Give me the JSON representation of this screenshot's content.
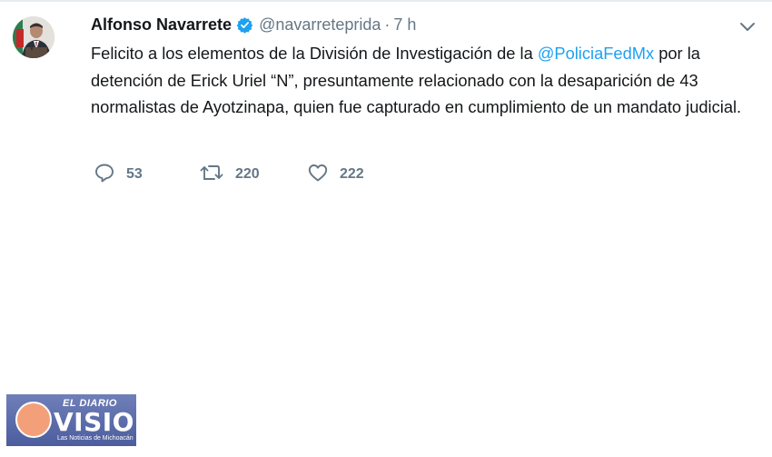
{
  "tweet": {
    "author": {
      "name": "Alfonso Navarrete",
      "handle": "@navarreteprida",
      "verified": true
    },
    "separator": "·",
    "time": "7 h",
    "text_parts": {
      "before": "Felicito a los elementos de la División de Investigación de la ",
      "mention": "@PoliciaFedMx",
      "after": " por la detención de Erick Uriel “N”, presuntamente relacionado con la desaparición de 43 normalistas de Ayotzinapa, quien fue capturado en cumplimiento de un mandato judicial."
    },
    "actions": {
      "replies": "53",
      "retweets": "220",
      "likes": "222"
    }
  },
  "icons": {
    "reply": "reply-icon",
    "retweet": "retweet-icon",
    "like": "heart-icon",
    "menu": "chevron-down-icon",
    "verified": "verified-badge-icon"
  },
  "colors": {
    "text": "#14171a",
    "muted": "#657786",
    "mention": "#1da1f2",
    "verified": "#1da1f2",
    "logo_background": "#5566a8",
    "logo_sun": "#f3a07a"
  },
  "watermark": {
    "top": "EL DIARIO",
    "main": "VISION",
    "tagline": "Las Noticias de Michoacán"
  }
}
